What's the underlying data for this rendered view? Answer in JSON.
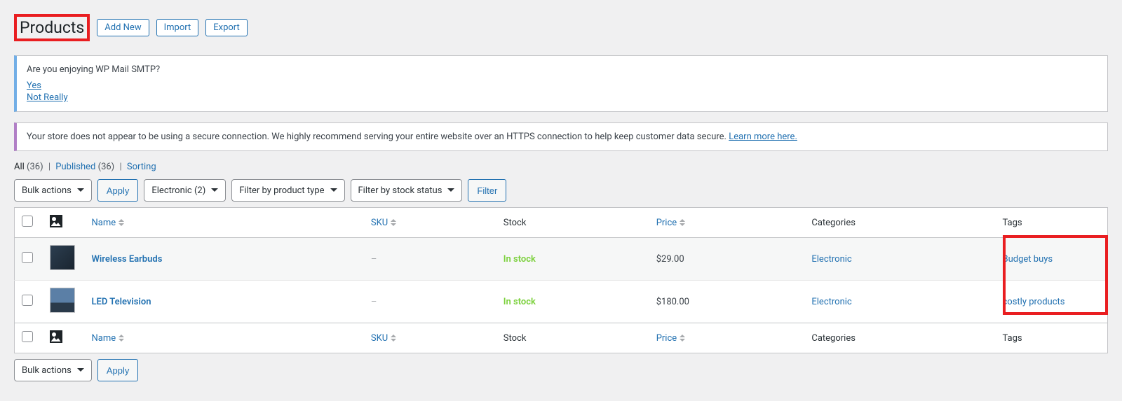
{
  "header": {
    "page_title": "Products",
    "add_new": "Add New",
    "import": "Import",
    "export": "Export"
  },
  "notices": {
    "smtp": {
      "question": "Are you enjoying WP Mail SMTP?",
      "yes": "Yes",
      "no": "Not Really"
    },
    "https": {
      "text": "Your store does not appear to be using a secure connection. We highly recommend serving your entire website over an HTTPS connection to help keep customer data secure. ",
      "link": "Learn more here."
    }
  },
  "subsubsub": {
    "all_label": "All",
    "all_count": "(36)",
    "published_label": "Published",
    "published_count": "(36)",
    "sorting": "Sorting"
  },
  "filters": {
    "bulk_actions": "Bulk actions",
    "apply": "Apply",
    "category": "Electronic  (2)",
    "product_type": "Filter by product type",
    "stock_status": "Filter by stock status",
    "filter": "Filter"
  },
  "columns": {
    "name": "Name",
    "sku": "SKU",
    "stock": "Stock",
    "price": "Price",
    "categories": "Categories",
    "tags": "Tags"
  },
  "rows": [
    {
      "name": "Wireless Earbuds",
      "sku": "–",
      "stock": "In stock",
      "price": "$29.00",
      "category": "Electronic",
      "tag": "Budget buys"
    },
    {
      "name": "LED Television",
      "sku": "–",
      "stock": "In stock",
      "price": "$180.00",
      "category": "Electronic",
      "tag": "costly products"
    }
  ],
  "footer": {
    "bulk_actions": "Bulk actions",
    "apply": "Apply"
  }
}
